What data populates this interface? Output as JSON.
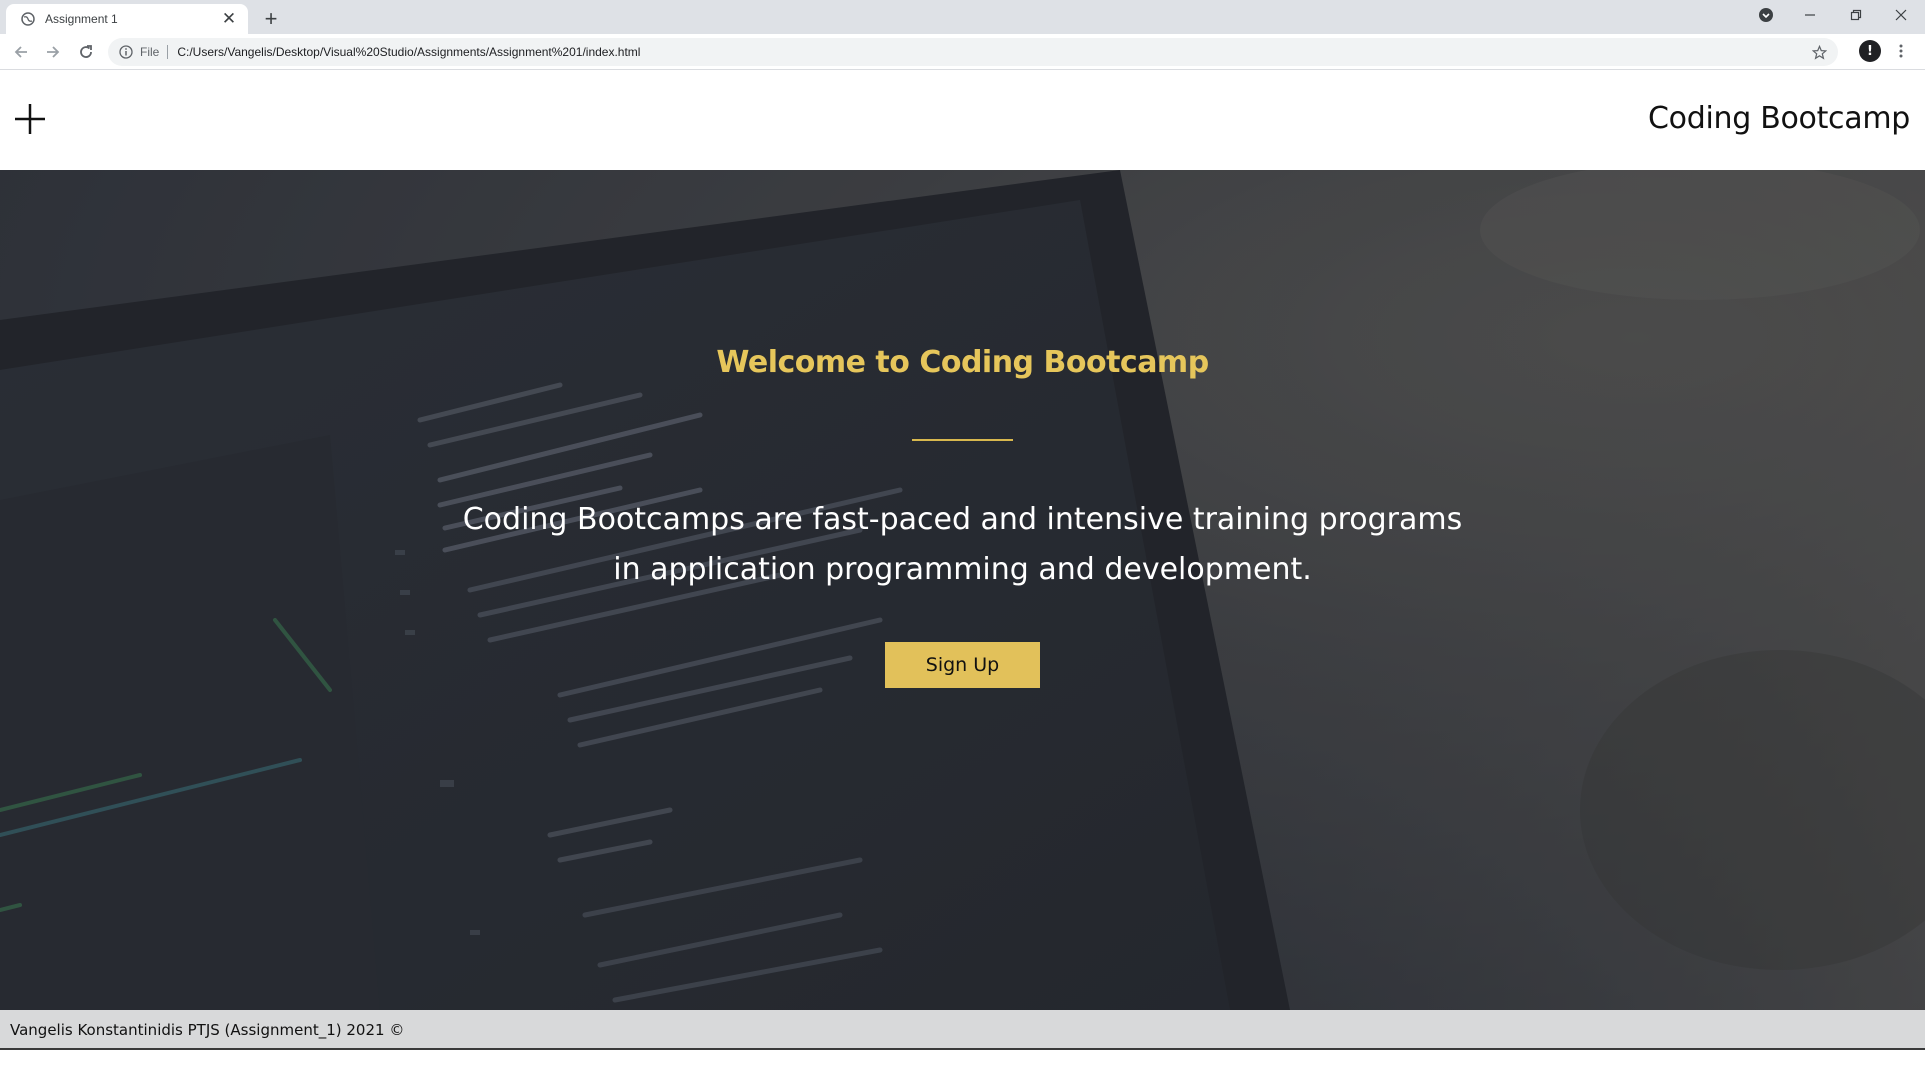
{
  "browser": {
    "tab_title": "Assignment 1",
    "tab_close_glyph": "✕",
    "new_tab_glyph": "+",
    "scheme_label": "File",
    "url": "C:/Users/Vangelis/Desktop/Visual%20Studio/Assignments/Assignment%201/index.html",
    "avatar_glyph": "!"
  },
  "navbar": {
    "brand": "Coding Bootcamp"
  },
  "hero": {
    "title": "Welcome to Coding Bootcamp",
    "text_line1": "Coding Bootcamps are fast-paced and intensive training programs",
    "text_line2": "in application programming and development.",
    "button_label": "Sign Up"
  },
  "footer": {
    "text": "Vangelis Konstantinidis PTJS (Assignment_1) 2021 ©"
  },
  "colors": {
    "accent_gold": "#e2c15a",
    "title_gold": "#e6c65b",
    "hero_dark": "#2b2e36",
    "footer_bg": "#d8d9da"
  }
}
